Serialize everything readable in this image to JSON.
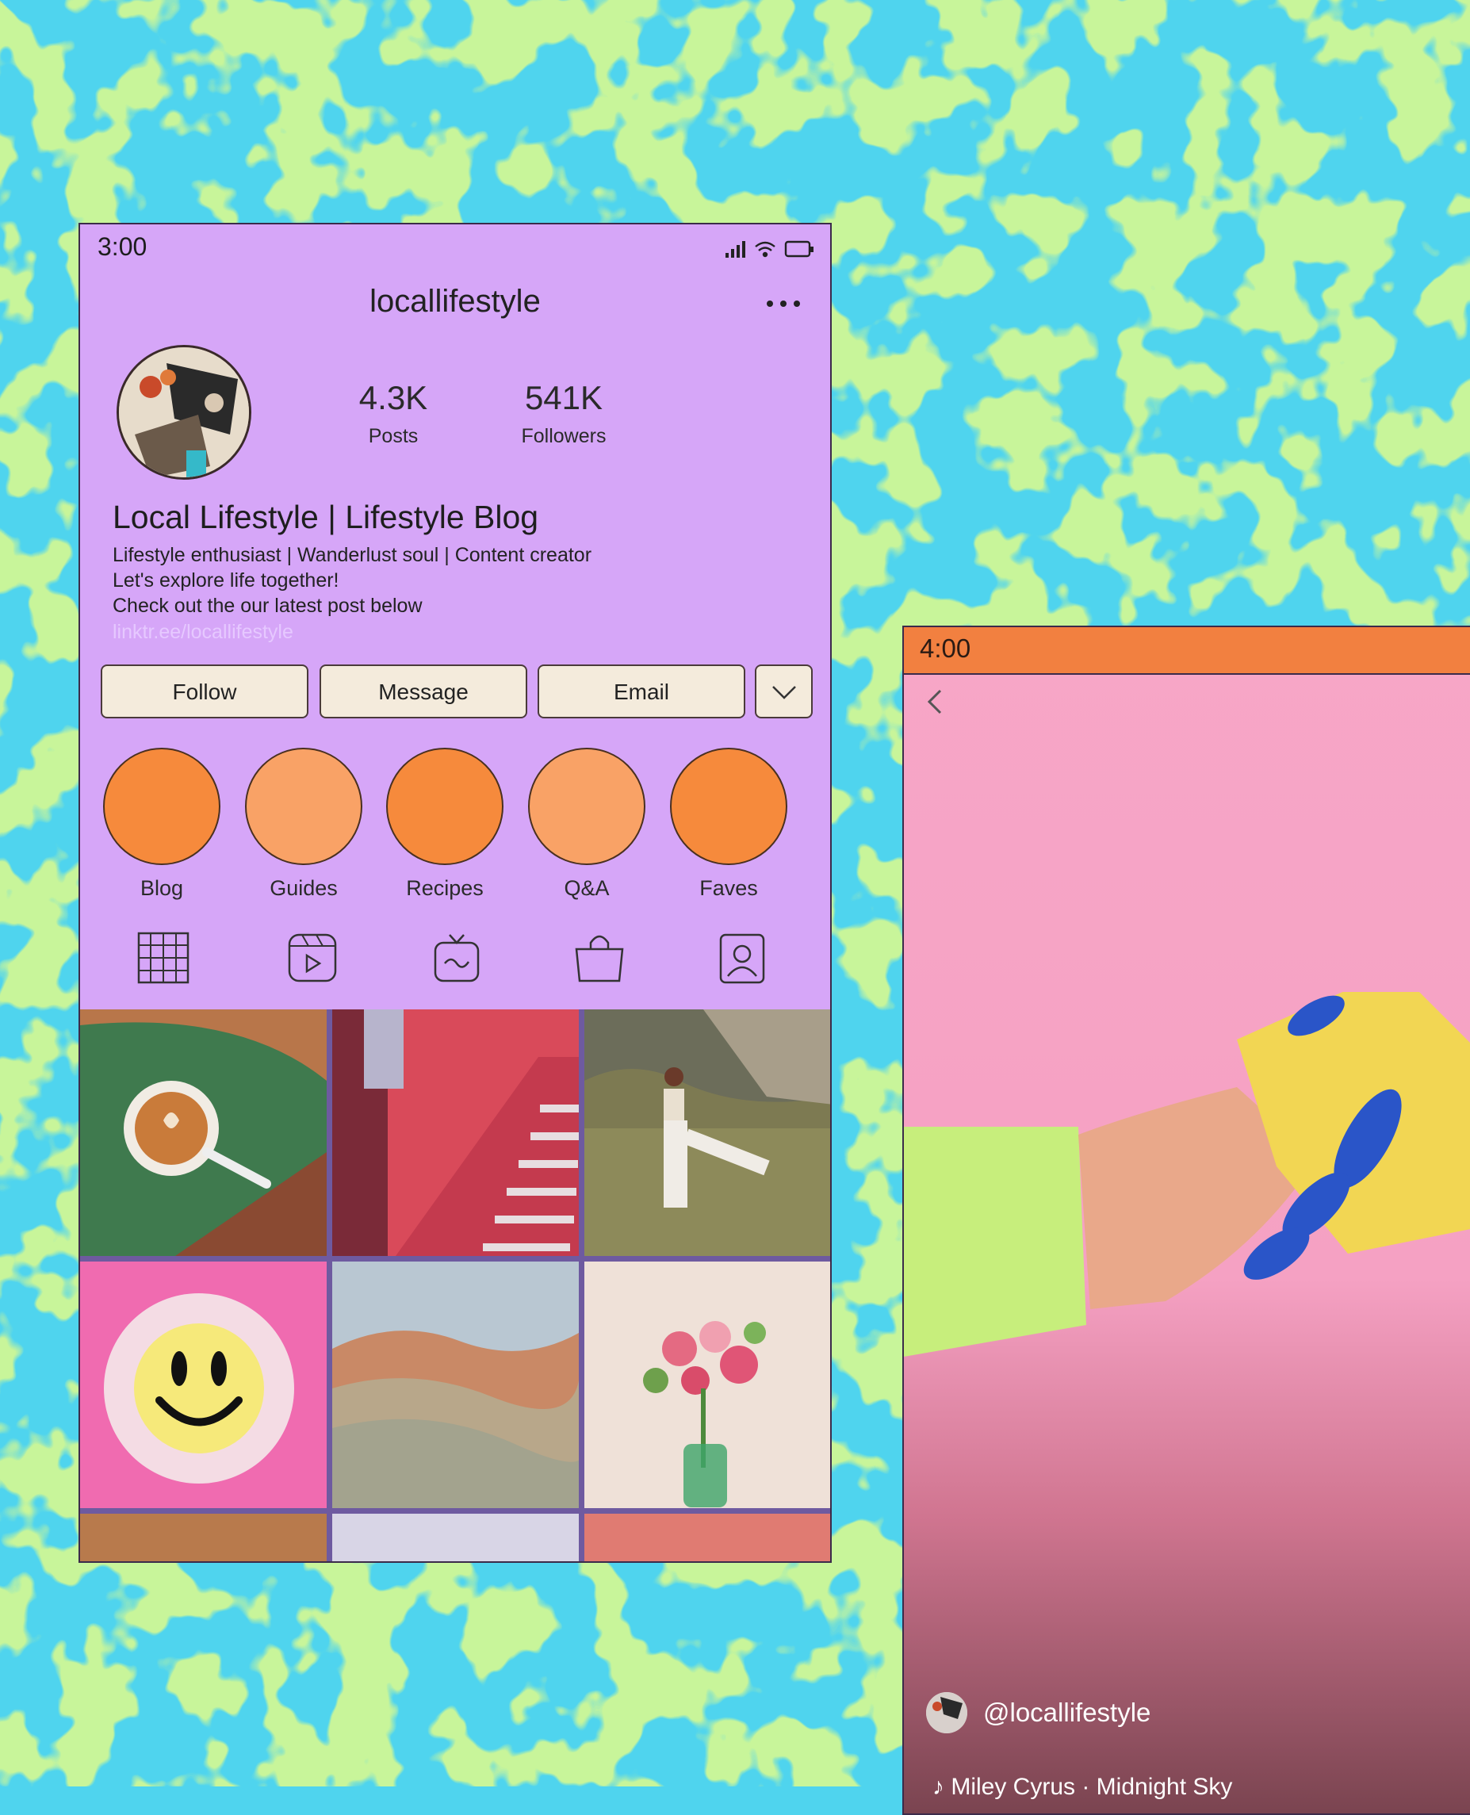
{
  "profile": {
    "status_time": "3:00",
    "username": "locallifestyle",
    "stats": {
      "posts_value": "4.3K",
      "posts_label": "Posts",
      "followers_value": "541K",
      "followers_label": "Followers"
    },
    "bio": {
      "name": "Local Lifestyle | Lifestyle Blog",
      "line1": "Lifestyle enthusiast | Wanderlust soul | Content creator",
      "line2": "Let's explore life together!",
      "line3": "Check out the our latest post below",
      "link": "linktr.ee/locallifestyle"
    },
    "buttons": {
      "follow": "Follow",
      "message": "Message",
      "email": "Email"
    },
    "highlights": [
      {
        "label": "Blog",
        "color": "#f68a3c"
      },
      {
        "label": "Guides",
        "color": "#f9a266"
      },
      {
        "label": "Recipes",
        "color": "#f68a3c"
      },
      {
        "label": "Q&A",
        "color": "#f9a266"
      },
      {
        "label": "Faves",
        "color": "#f68a3c"
      }
    ],
    "tabs": [
      "grid-icon",
      "reels-icon",
      "igtv-icon",
      "shop-icon",
      "tagged-icon"
    ]
  },
  "reel": {
    "status_time": "4:00",
    "username": "@locallifestyle",
    "audio": "Miley Cyrus · Midnight Sky"
  },
  "colors": {
    "profile_bg": "#d6a6f8",
    "reel_status_bar": "#f28040",
    "pattern_blue": "#4fd4ee",
    "pattern_green": "#c8f59a"
  }
}
